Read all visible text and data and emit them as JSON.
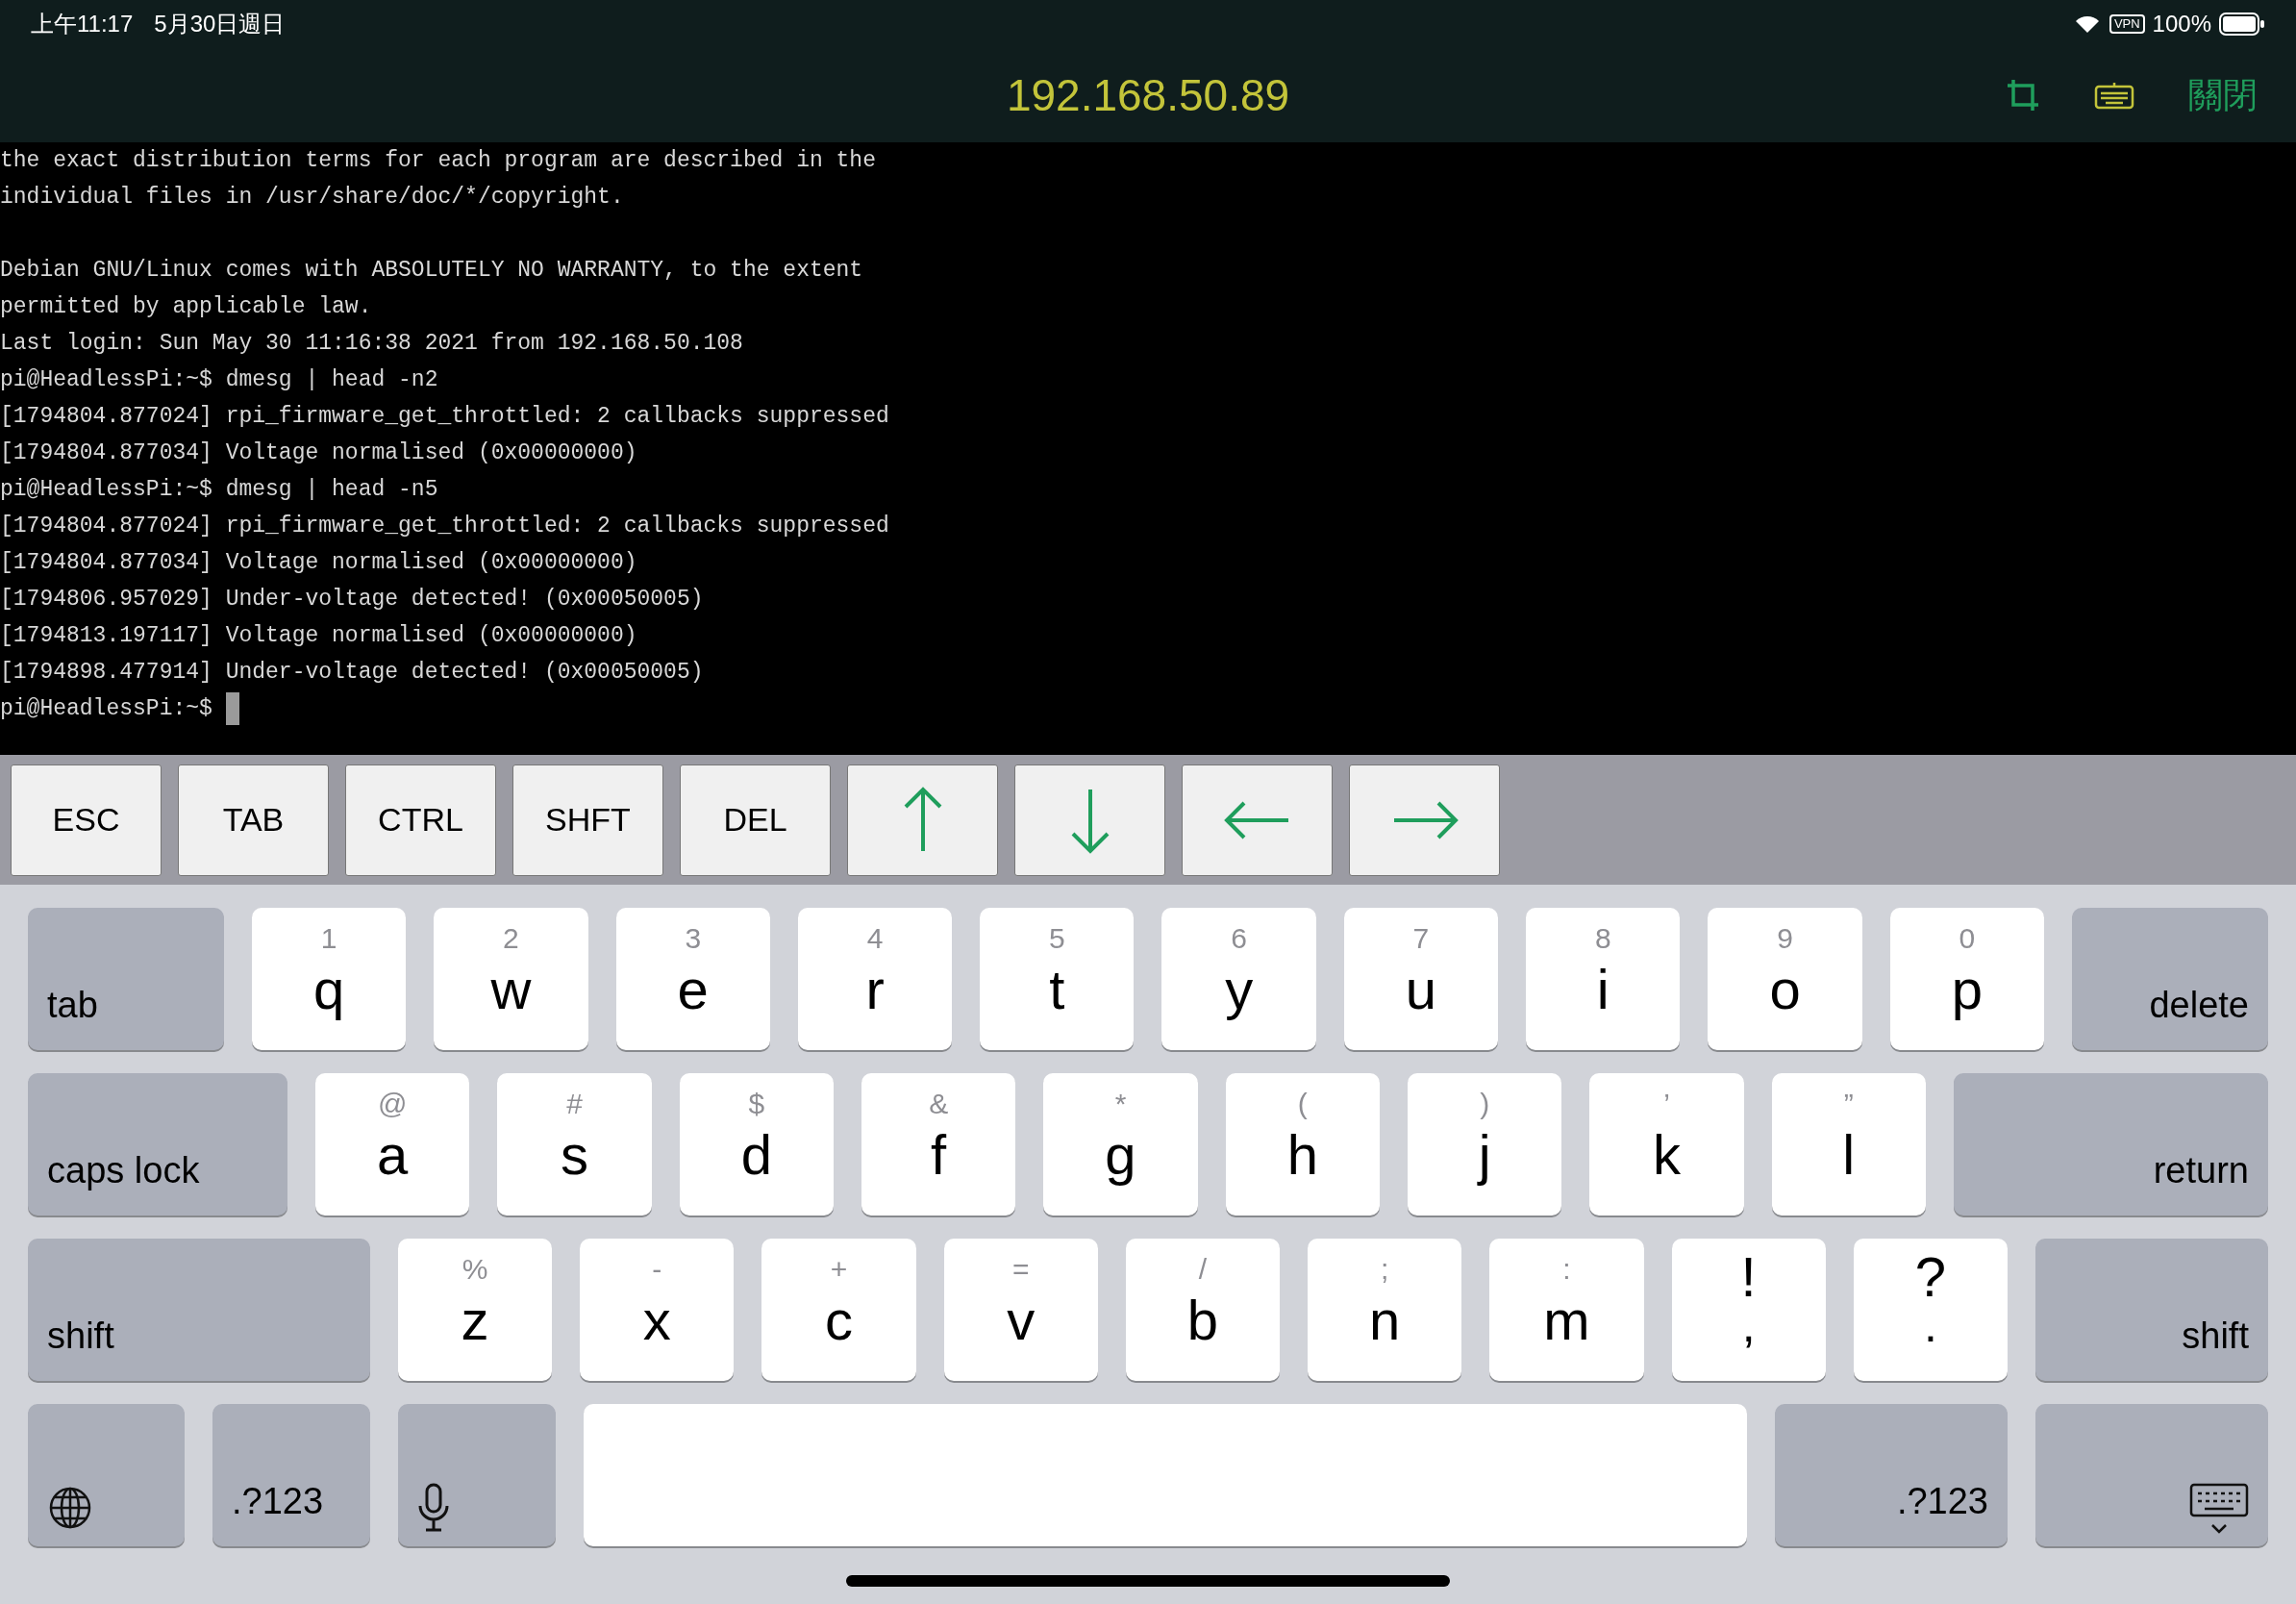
{
  "status_bar": {
    "time": "上午11:17",
    "date": "5月30日週日",
    "vpn": "VPN",
    "battery": "100%"
  },
  "title_bar": {
    "title": "192.168.50.89",
    "close": "關閉"
  },
  "terminal": {
    "lines": [
      {
        "kind": "text",
        "text": "the exact distribution terms for each program are described in the"
      },
      {
        "kind": "text",
        "text": "individual files in /usr/share/doc/*/copyright."
      },
      {
        "kind": "blank"
      },
      {
        "kind": "text",
        "text": "Debian GNU/Linux comes with ABSOLUTELY NO WARRANTY, to the extent"
      },
      {
        "kind": "text",
        "text": "permitted by applicable law."
      },
      {
        "kind": "text",
        "text": "Last login: Sun May 30 11:16:38 2021 from 192.168.50.108"
      },
      {
        "kind": "text",
        "text": "pi@HeadlessPi:~$ dmesg | head -n2"
      },
      {
        "kind": "text",
        "text": "[1794804.877024] rpi_firmware_get_throttled: 2 callbacks suppressed"
      },
      {
        "kind": "text",
        "text": "[1794804.877034] Voltage normalised (0x00000000)"
      },
      {
        "kind": "text",
        "text": "pi@HeadlessPi:~$ dmesg | head -n5"
      },
      {
        "kind": "text",
        "text": "[1794804.877024] rpi_firmware_get_throttled: 2 callbacks suppressed"
      },
      {
        "kind": "text",
        "text": "[1794804.877034] Voltage normalised (0x00000000)"
      },
      {
        "kind": "text",
        "text": "[1794806.957029] Under-voltage detected! (0x00050005)"
      },
      {
        "kind": "text",
        "text": "[1794813.197117] Voltage normalised (0x00000000)"
      },
      {
        "kind": "text",
        "text": "[1794898.477914] Under-voltage detected! (0x00050005)"
      },
      {
        "kind": "prompt",
        "text": "pi@HeadlessPi:~$ "
      }
    ]
  },
  "extra_keys": [
    {
      "kind": "text",
      "label": "ESC"
    },
    {
      "kind": "text",
      "label": "TAB"
    },
    {
      "kind": "text",
      "label": "CTRL"
    },
    {
      "kind": "text",
      "label": "SHFT"
    },
    {
      "kind": "text",
      "label": "DEL"
    },
    {
      "kind": "arrow-up"
    },
    {
      "kind": "arrow-down"
    },
    {
      "kind": "arrow-left"
    },
    {
      "kind": "arrow-right"
    }
  ],
  "keyboard": {
    "rows": [
      [
        {
          "kind": "func-left",
          "label": "tab"
        },
        {
          "kind": "letter",
          "label": "q",
          "hint": "1"
        },
        {
          "kind": "letter",
          "label": "w",
          "hint": "2"
        },
        {
          "kind": "letter",
          "label": "e",
          "hint": "3"
        },
        {
          "kind": "letter",
          "label": "r",
          "hint": "4"
        },
        {
          "kind": "letter",
          "label": "t",
          "hint": "5"
        },
        {
          "kind": "letter",
          "label": "y",
          "hint": "6"
        },
        {
          "kind": "letter",
          "label": "u",
          "hint": "7"
        },
        {
          "kind": "letter",
          "label": "i",
          "hint": "8"
        },
        {
          "kind": "letter",
          "label": "o",
          "hint": "9"
        },
        {
          "kind": "letter",
          "label": "p",
          "hint": "0"
        },
        {
          "kind": "func-right",
          "label": "delete"
        }
      ],
      [
        {
          "kind": "func-left",
          "label": "caps lock"
        },
        {
          "kind": "letter",
          "label": "a",
          "hint": "@"
        },
        {
          "kind": "letter",
          "label": "s",
          "hint": "#"
        },
        {
          "kind": "letter",
          "label": "d",
          "hint": "$"
        },
        {
          "kind": "letter",
          "label": "f",
          "hint": "&"
        },
        {
          "kind": "letter",
          "label": "g",
          "hint": "*"
        },
        {
          "kind": "letter",
          "label": "h",
          "hint": "("
        },
        {
          "kind": "letter",
          "label": "j",
          "hint": ")"
        },
        {
          "kind": "letter",
          "label": "k",
          "hint": "’"
        },
        {
          "kind": "letter",
          "label": "l",
          "hint": "”"
        },
        {
          "kind": "func-right",
          "label": "return"
        }
      ],
      [
        {
          "kind": "func-left",
          "label": "shift"
        },
        {
          "kind": "letter",
          "label": "z",
          "hint": "%"
        },
        {
          "kind": "letter",
          "label": "x",
          "hint": "-"
        },
        {
          "kind": "letter",
          "label": "c",
          "hint": "+"
        },
        {
          "kind": "letter",
          "label": "v",
          "hint": "="
        },
        {
          "kind": "letter",
          "label": "b",
          "hint": "/"
        },
        {
          "kind": "letter",
          "label": "n",
          "hint": ";"
        },
        {
          "kind": "letter",
          "label": "m",
          "hint": ":"
        },
        {
          "kind": "punct",
          "label": ",",
          "hint": "!"
        },
        {
          "kind": "punct",
          "label": ".",
          "hint": "?"
        },
        {
          "kind": "func-right",
          "label": "shift"
        }
      ],
      [
        {
          "kind": "globe"
        },
        {
          "kind": "func-left",
          "label": ".?123"
        },
        {
          "kind": "mic"
        },
        {
          "kind": "space"
        },
        {
          "kind": "func-right",
          "label": ".?123"
        },
        {
          "kind": "dismiss"
        }
      ]
    ]
  }
}
